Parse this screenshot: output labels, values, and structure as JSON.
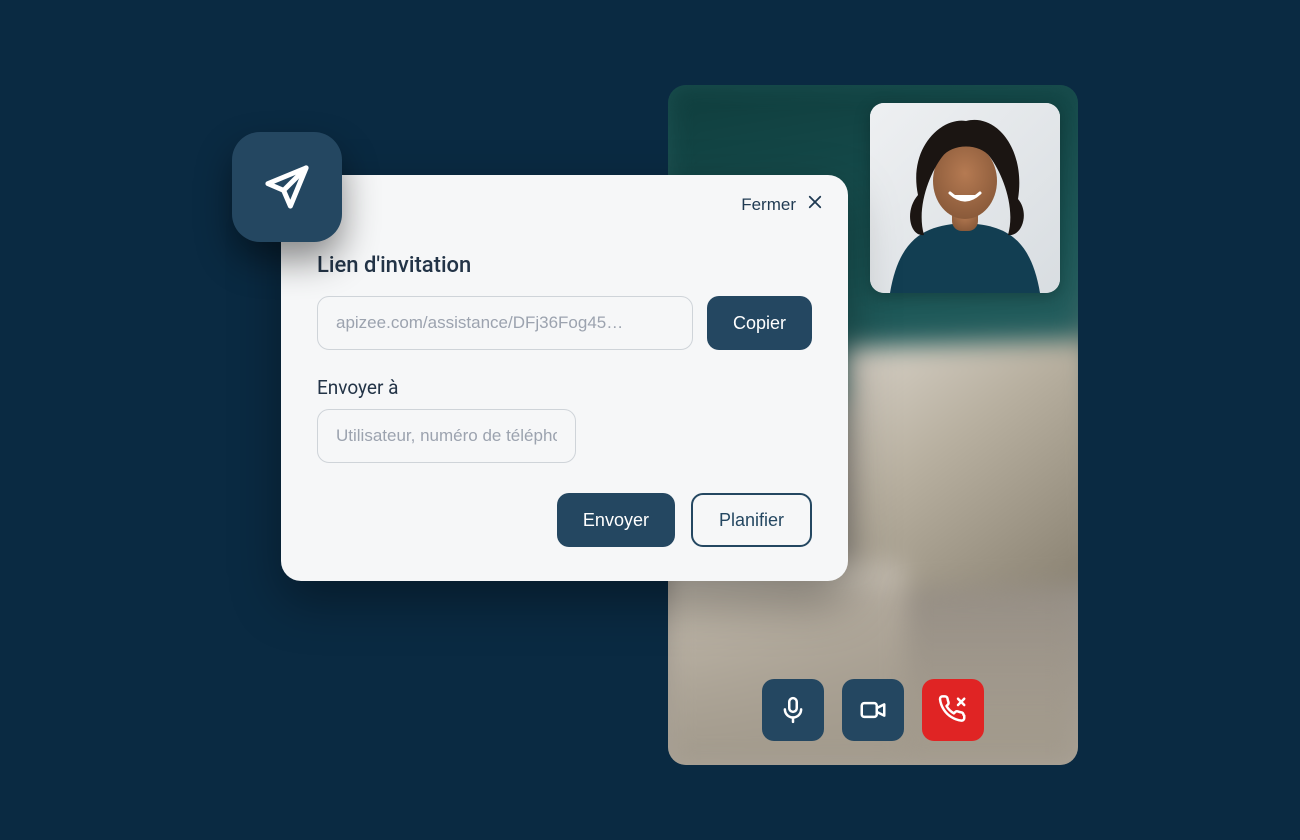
{
  "modal": {
    "close_label": "Fermer",
    "title": "Lien d'invitation",
    "link_value": "apizee.com/assistance/DFj36Fog45…",
    "copy_label": "Copier",
    "send_to_label": "Envoyer à",
    "send_to_placeholder": "Utilisateur, numéro de téléphone mobile, e-mail",
    "send_label": "Envoyer",
    "schedule_label": "Planifier"
  },
  "icons": {
    "badge": "send-plane-icon",
    "close": "close-icon",
    "mic": "microphone-icon",
    "camera": "camera-icon",
    "hangup": "hangup-icon"
  },
  "colors": {
    "bg": "#0a2a42",
    "primary": "#244761",
    "danger": "#e02424",
    "panel": "#f6f7f8",
    "border": "#cfd4d9",
    "text": "#233447",
    "muted": "#9ca3af"
  }
}
